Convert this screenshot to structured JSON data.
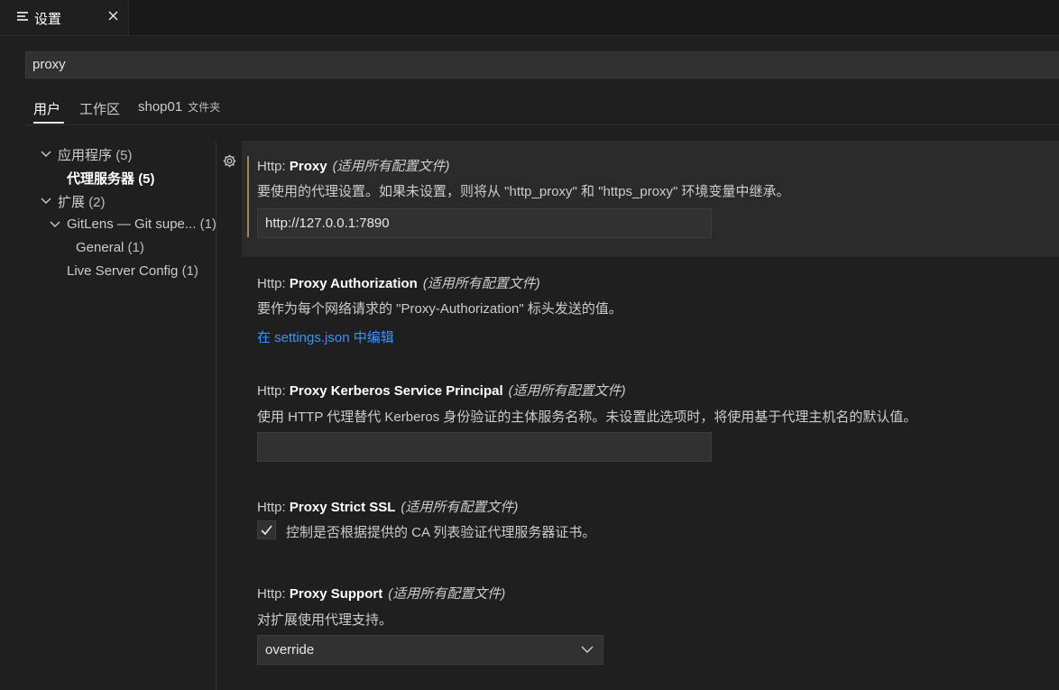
{
  "tab": {
    "title": "设置",
    "icon": "settings-editor-icon"
  },
  "search": {
    "value": "proxy"
  },
  "scopes": {
    "user": "用户",
    "workspace": "工作区",
    "folder": "shop01",
    "folder_sub": "文件夹"
  },
  "toc": {
    "app": {
      "label": "应用程序",
      "count": "(5)"
    },
    "proxy": {
      "label": "代理服务器",
      "count": "(5)"
    },
    "ext": {
      "label": "扩展",
      "count": "(2)"
    },
    "gitlens": {
      "label": "GitLens — Git supe...",
      "count": "(1)"
    },
    "general": {
      "label": "General",
      "count": "(1)"
    },
    "liveserver": {
      "label": "Live Server Config",
      "count": "(1)"
    }
  },
  "settings": {
    "scope_note": "(适用所有配置文件)",
    "proxy": {
      "category": "Http: ",
      "name": "Proxy",
      "description": "要使用的代理设置。如果未设置，则将从 \"http_proxy\" 和 \"https_proxy\" 环境变量中继承。",
      "value": "http://127.0.0.1:7890"
    },
    "proxy_auth": {
      "category": "Http: ",
      "name": "Proxy Authorization",
      "description": "要作为每个网络请求的 \"Proxy-Authorization\" 标头发送的值。",
      "link": "在 settings.json 中编辑"
    },
    "kerberos": {
      "category": "Http: ",
      "name": "Proxy Kerberos Service Principal",
      "description": "使用 HTTP 代理替代 Kerberos 身份验证的主体服务名称。未设置此选项时，将使用基于代理主机名的默认值。",
      "value": ""
    },
    "strict_ssl": {
      "category": "Http: ",
      "name": "Proxy Strict SSL",
      "description": "控制是否根据提供的 CA 列表验证代理服务器证书。",
      "checked": true
    },
    "support": {
      "category": "Http: ",
      "name": "Proxy Support",
      "description": "对扩展使用代理支持。",
      "value": "override"
    }
  }
}
